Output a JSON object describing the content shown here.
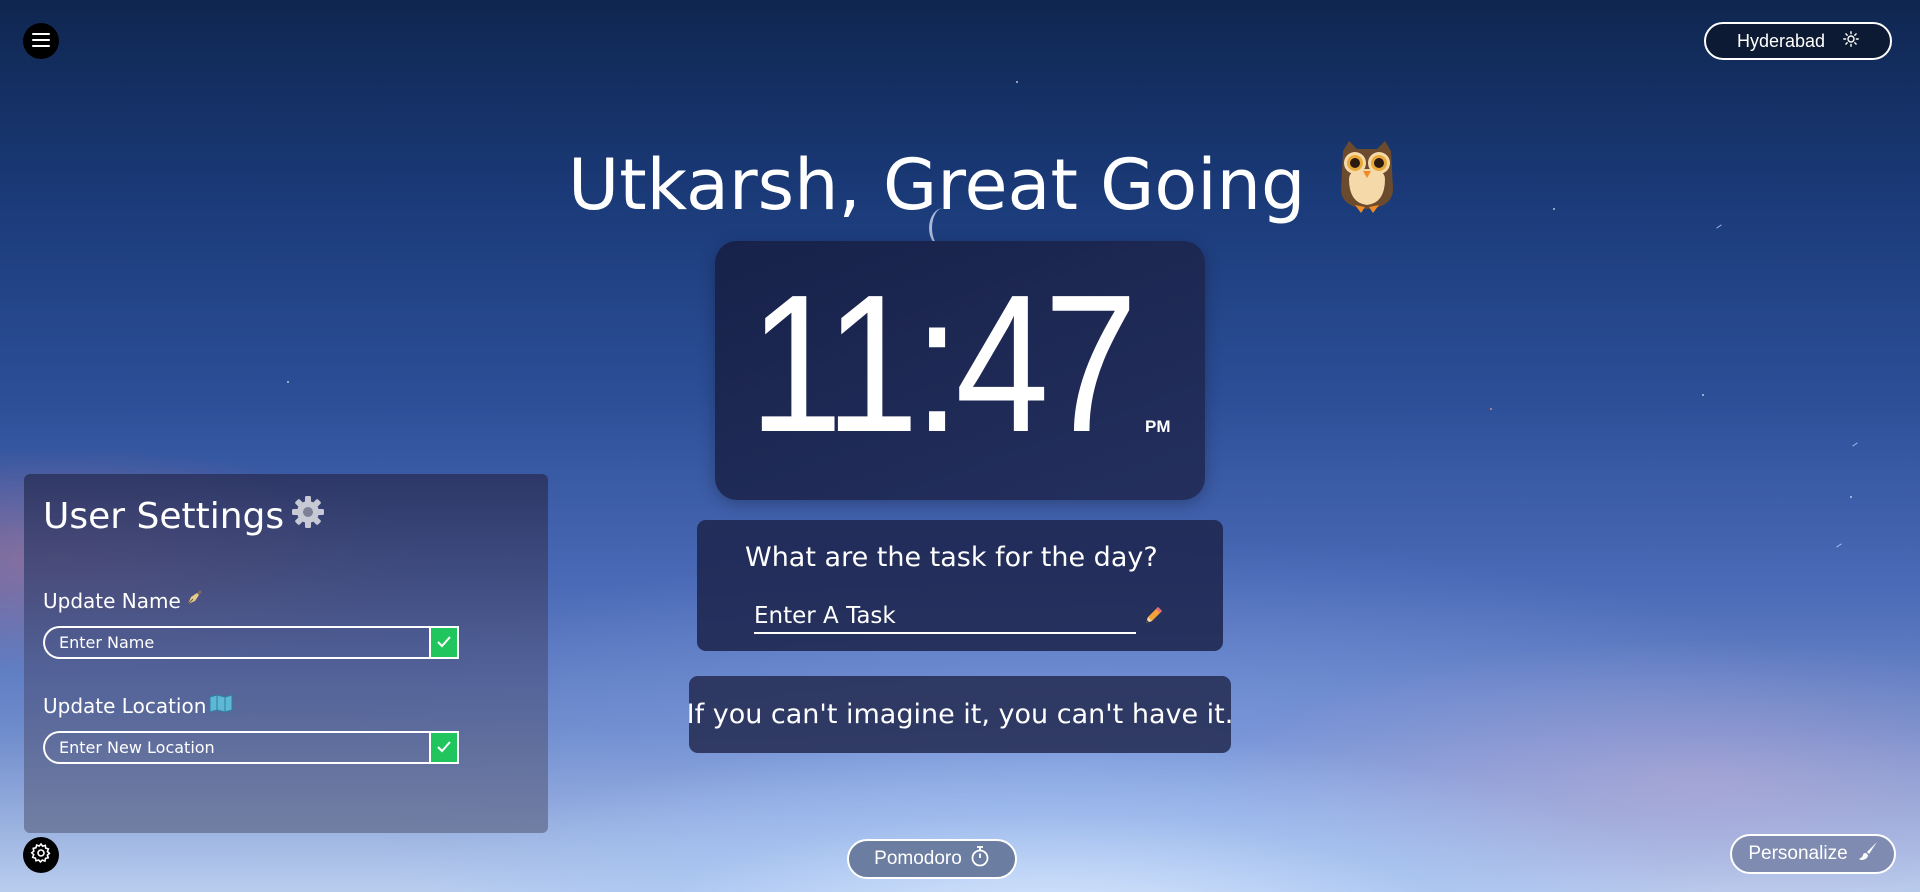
{
  "greeting": {
    "text": "Utkarsh, Great Going",
    "icon": "owl-icon"
  },
  "location": {
    "name": "Hyderabad",
    "icon": "sun-icon"
  },
  "clock": {
    "time": "11:47",
    "period": "PM"
  },
  "tasks": {
    "question": "What are the task for the day?",
    "input_placeholder": "Enter A Task",
    "icon": "pencil-icon"
  },
  "quote": {
    "text": "If you can't imagine it, you can't have it."
  },
  "user_settings": {
    "title": "User Settings",
    "title_icon": "gear-icon",
    "name": {
      "label": "Update Name",
      "icon": "pen-nib-icon",
      "placeholder": "Enter Name"
    },
    "location": {
      "label": "Update Location",
      "icon": "map-icon",
      "placeholder": "Enter New Location"
    }
  },
  "pomodoro": {
    "label": "Pomodoro",
    "icon": "stopwatch-icon"
  },
  "personalize": {
    "label": "Personalize",
    "icon": "paintbrush-icon"
  },
  "colors": {
    "submit_green": "#21c55d",
    "card_navy": "#1c2552",
    "sky_top": "#0f2650",
    "sky_bottom": "#b9cdee"
  }
}
